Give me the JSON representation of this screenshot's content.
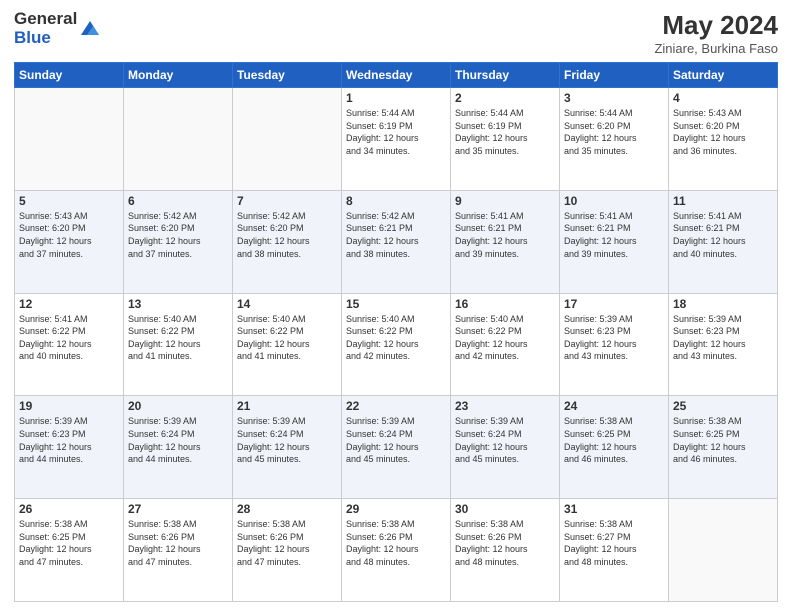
{
  "header": {
    "logo_general": "General",
    "logo_blue": "Blue",
    "month_year": "May 2024",
    "location": "Ziniare, Burkina Faso"
  },
  "columns": [
    "Sunday",
    "Monday",
    "Tuesday",
    "Wednesday",
    "Thursday",
    "Friday",
    "Saturday"
  ],
  "weeks": [
    {
      "days": [
        {
          "number": "",
          "info": ""
        },
        {
          "number": "",
          "info": ""
        },
        {
          "number": "",
          "info": ""
        },
        {
          "number": "1",
          "info": "Sunrise: 5:44 AM\nSunset: 6:19 PM\nDaylight: 12 hours\nand 34 minutes."
        },
        {
          "number": "2",
          "info": "Sunrise: 5:44 AM\nSunset: 6:19 PM\nDaylight: 12 hours\nand 35 minutes."
        },
        {
          "number": "3",
          "info": "Sunrise: 5:44 AM\nSunset: 6:20 PM\nDaylight: 12 hours\nand 35 minutes."
        },
        {
          "number": "4",
          "info": "Sunrise: 5:43 AM\nSunset: 6:20 PM\nDaylight: 12 hours\nand 36 minutes."
        }
      ]
    },
    {
      "days": [
        {
          "number": "5",
          "info": "Sunrise: 5:43 AM\nSunset: 6:20 PM\nDaylight: 12 hours\nand 37 minutes."
        },
        {
          "number": "6",
          "info": "Sunrise: 5:42 AM\nSunset: 6:20 PM\nDaylight: 12 hours\nand 37 minutes."
        },
        {
          "number": "7",
          "info": "Sunrise: 5:42 AM\nSunset: 6:20 PM\nDaylight: 12 hours\nand 38 minutes."
        },
        {
          "number": "8",
          "info": "Sunrise: 5:42 AM\nSunset: 6:21 PM\nDaylight: 12 hours\nand 38 minutes."
        },
        {
          "number": "9",
          "info": "Sunrise: 5:41 AM\nSunset: 6:21 PM\nDaylight: 12 hours\nand 39 minutes."
        },
        {
          "number": "10",
          "info": "Sunrise: 5:41 AM\nSunset: 6:21 PM\nDaylight: 12 hours\nand 39 minutes."
        },
        {
          "number": "11",
          "info": "Sunrise: 5:41 AM\nSunset: 6:21 PM\nDaylight: 12 hours\nand 40 minutes."
        }
      ]
    },
    {
      "days": [
        {
          "number": "12",
          "info": "Sunrise: 5:41 AM\nSunset: 6:22 PM\nDaylight: 12 hours\nand 40 minutes."
        },
        {
          "number": "13",
          "info": "Sunrise: 5:40 AM\nSunset: 6:22 PM\nDaylight: 12 hours\nand 41 minutes."
        },
        {
          "number": "14",
          "info": "Sunrise: 5:40 AM\nSunset: 6:22 PM\nDaylight: 12 hours\nand 41 minutes."
        },
        {
          "number": "15",
          "info": "Sunrise: 5:40 AM\nSunset: 6:22 PM\nDaylight: 12 hours\nand 42 minutes."
        },
        {
          "number": "16",
          "info": "Sunrise: 5:40 AM\nSunset: 6:22 PM\nDaylight: 12 hours\nand 42 minutes."
        },
        {
          "number": "17",
          "info": "Sunrise: 5:39 AM\nSunset: 6:23 PM\nDaylight: 12 hours\nand 43 minutes."
        },
        {
          "number": "18",
          "info": "Sunrise: 5:39 AM\nSunset: 6:23 PM\nDaylight: 12 hours\nand 43 minutes."
        }
      ]
    },
    {
      "days": [
        {
          "number": "19",
          "info": "Sunrise: 5:39 AM\nSunset: 6:23 PM\nDaylight: 12 hours\nand 44 minutes."
        },
        {
          "number": "20",
          "info": "Sunrise: 5:39 AM\nSunset: 6:24 PM\nDaylight: 12 hours\nand 44 minutes."
        },
        {
          "number": "21",
          "info": "Sunrise: 5:39 AM\nSunset: 6:24 PM\nDaylight: 12 hours\nand 45 minutes."
        },
        {
          "number": "22",
          "info": "Sunrise: 5:39 AM\nSunset: 6:24 PM\nDaylight: 12 hours\nand 45 minutes."
        },
        {
          "number": "23",
          "info": "Sunrise: 5:39 AM\nSunset: 6:24 PM\nDaylight: 12 hours\nand 45 minutes."
        },
        {
          "number": "24",
          "info": "Sunrise: 5:38 AM\nSunset: 6:25 PM\nDaylight: 12 hours\nand 46 minutes."
        },
        {
          "number": "25",
          "info": "Sunrise: 5:38 AM\nSunset: 6:25 PM\nDaylight: 12 hours\nand 46 minutes."
        }
      ]
    },
    {
      "days": [
        {
          "number": "26",
          "info": "Sunrise: 5:38 AM\nSunset: 6:25 PM\nDaylight: 12 hours\nand 47 minutes."
        },
        {
          "number": "27",
          "info": "Sunrise: 5:38 AM\nSunset: 6:26 PM\nDaylight: 12 hours\nand 47 minutes."
        },
        {
          "number": "28",
          "info": "Sunrise: 5:38 AM\nSunset: 6:26 PM\nDaylight: 12 hours\nand 47 minutes."
        },
        {
          "number": "29",
          "info": "Sunrise: 5:38 AM\nSunset: 6:26 PM\nDaylight: 12 hours\nand 48 minutes."
        },
        {
          "number": "30",
          "info": "Sunrise: 5:38 AM\nSunset: 6:26 PM\nDaylight: 12 hours\nand 48 minutes."
        },
        {
          "number": "31",
          "info": "Sunrise: 5:38 AM\nSunset: 6:27 PM\nDaylight: 12 hours\nand 48 minutes."
        },
        {
          "number": "",
          "info": ""
        }
      ]
    }
  ]
}
